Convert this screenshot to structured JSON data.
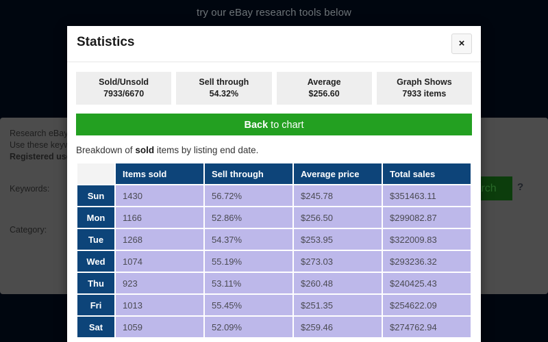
{
  "background": {
    "banner_text": "try our eBay research tools below",
    "intro_line1": "Research eBay c",
    "intro_line2": "Use these keyw",
    "intro_line3": "Registered use",
    "keywords_label": "Keywords:",
    "category_label": "Category:",
    "search_button_label": "Search",
    "help_label": "?",
    "colors": {
      "page_background": "#00060f",
      "panel": "#4c4c4c",
      "search_button": "#0c3d0c"
    }
  },
  "modal": {
    "title": "Statistics",
    "close_label": "×",
    "stats": [
      {
        "label": "Sold/Unsold",
        "value": "7933/6670"
      },
      {
        "label": "Sell through",
        "value": "54.32%"
      },
      {
        "label": "Average",
        "value": "$256.60"
      },
      {
        "label": "Graph Shows",
        "value": "7933 items"
      }
    ],
    "back_button": {
      "strong": "Back",
      "rest": " to chart"
    },
    "breakdown": {
      "before": "Breakdown of ",
      "strong": "sold",
      "after": " items by listing end date."
    },
    "table": {
      "corner_header": "",
      "columns": [
        "Items sold",
        "Sell through",
        "Average price",
        "Total sales"
      ],
      "rows": [
        {
          "day": "Sun",
          "items_sold": "1430",
          "sell_through": "56.72%",
          "average_price": "$245.78",
          "total_sales": "$351463.11"
        },
        {
          "day": "Mon",
          "items_sold": "1166",
          "sell_through": "52.86%",
          "average_price": "$256.50",
          "total_sales": "$299082.87"
        },
        {
          "day": "Tue",
          "items_sold": "1268",
          "sell_through": "54.37%",
          "average_price": "$253.95",
          "total_sales": "$322009.83"
        },
        {
          "day": "Wed",
          "items_sold": "1074",
          "sell_through": "55.19%",
          "average_price": "$273.03",
          "total_sales": "$293236.32"
        },
        {
          "day": "Thu",
          "items_sold": "923",
          "sell_through": "53.11%",
          "average_price": "$260.48",
          "total_sales": "$240425.43"
        },
        {
          "day": "Fri",
          "items_sold": "1013",
          "sell_through": "55.45%",
          "average_price": "$251.35",
          "total_sales": "$254622.09"
        },
        {
          "day": "Sat",
          "items_sold": "1059",
          "sell_through": "52.09%",
          "average_price": "$259.46",
          "total_sales": "$274762.94"
        }
      ]
    },
    "colors": {
      "header_navy": "#0d4479",
      "cell_lavender": "#bdb8ea",
      "accent_green": "#23a021",
      "stat_box": "#eeeeee"
    }
  }
}
